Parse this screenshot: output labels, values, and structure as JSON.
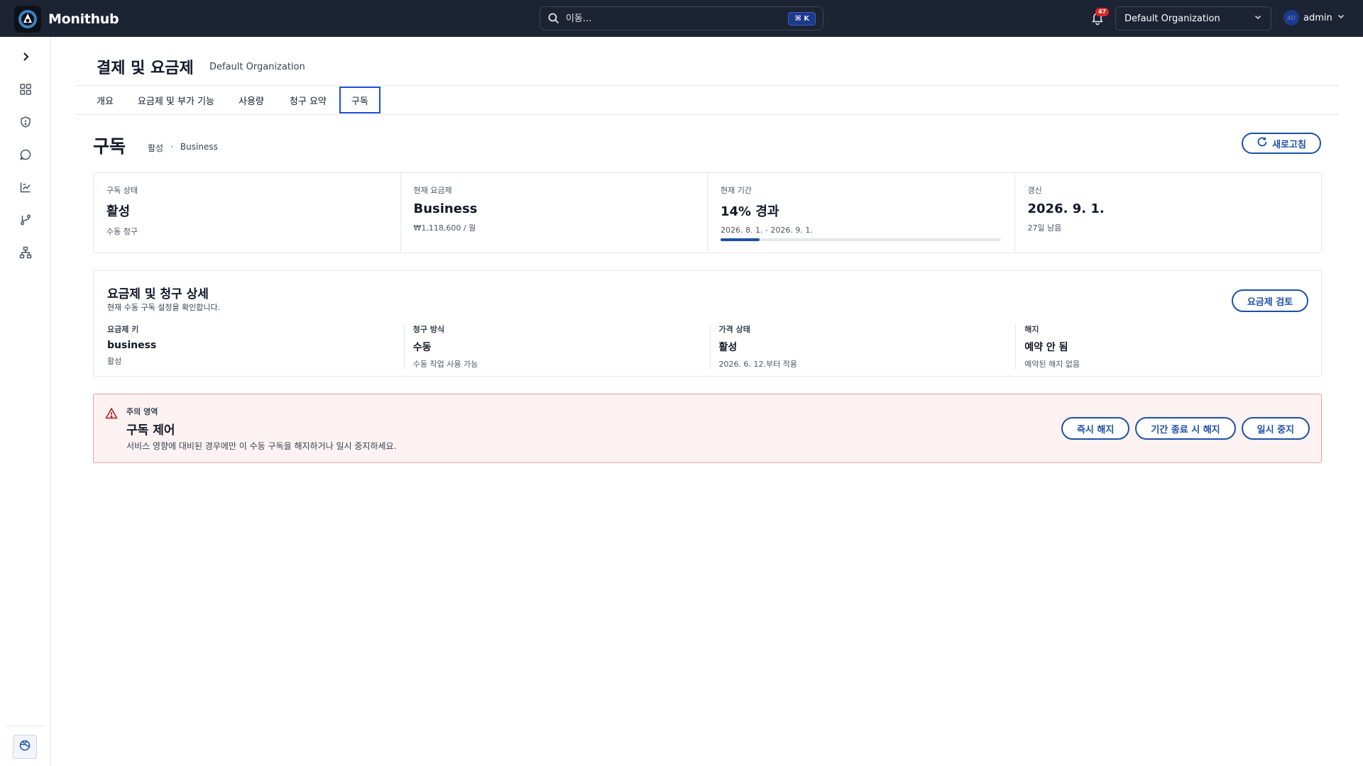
{
  "app": {
    "name": "Monithub"
  },
  "search": {
    "placeholder": "이동...",
    "shortcut": "⌘ K"
  },
  "notifications": {
    "count": "47"
  },
  "org_selector": {
    "value": "Default Organization"
  },
  "user": {
    "avatar_initials": "AD",
    "name": "admin"
  },
  "page": {
    "title": "결제 및 요금제",
    "org": "Default Organization"
  },
  "tabs": [
    {
      "label": "개요"
    },
    {
      "label": "요금제 및 부가 기능"
    },
    {
      "label": "사용량"
    },
    {
      "label": "청구 요약"
    },
    {
      "label": "구독",
      "active": true
    }
  ],
  "section": {
    "title": "구독",
    "status": "활성",
    "separator": "·",
    "plan": "Business",
    "refresh_label": "새로고침"
  },
  "stats": [
    {
      "label": "구독 상태",
      "value": "활성",
      "sub": "수동 청구"
    },
    {
      "label": "현재 요금제",
      "value": "Business",
      "sub": "₩1,118,600 / 월"
    },
    {
      "label": "현재 기간",
      "value": "14% 경과",
      "sub": "2026. 8. 1. - 2026. 9. 1.",
      "progress": 0.14
    },
    {
      "label": "갱신",
      "value": "2026. 9. 1.",
      "sub": "27일 남음"
    }
  ],
  "details": {
    "title": "요금제 및 청구 상세",
    "subtitle": "현재 수동 구독 설정을 확인합니다.",
    "review_label": "요금제 검토",
    "items": [
      {
        "label": "요금제 키",
        "value": "business",
        "sub": "활성"
      },
      {
        "label": "청구 방식",
        "value": "수동",
        "sub": "수동 작업 사용 가능"
      },
      {
        "label": "가격 상태",
        "value": "활성",
        "sub": "2026. 6. 12.부터 적용"
      },
      {
        "label": "해지",
        "value": "예약 안 됨",
        "sub": "예약된 해지 없음"
      }
    ]
  },
  "danger": {
    "label": "주의 영역",
    "title": "구독 제어",
    "description": "서비스 영향에 대비된 경우에만 이 수동 구독을 해지하거나 일시 중지하세요.",
    "actions": [
      {
        "label": "즉시 해지"
      },
      {
        "label": "기간 종료 시 해지"
      },
      {
        "label": "일시 중지"
      }
    ]
  },
  "colors": {
    "topbar": "#1c2333",
    "accent": "#1e4fa8",
    "danger_bg": "#fdf2f2",
    "danger_border": "#e5a3a3"
  },
  "icons": {
    "sidebar": [
      "chevron-right-icon",
      "dashboard-grid-icon",
      "shield-icon",
      "chat-bubble-icon",
      "chart-icon",
      "git-branch-icon",
      "org-tree-icon"
    ],
    "footer": "help-globe-icon"
  }
}
